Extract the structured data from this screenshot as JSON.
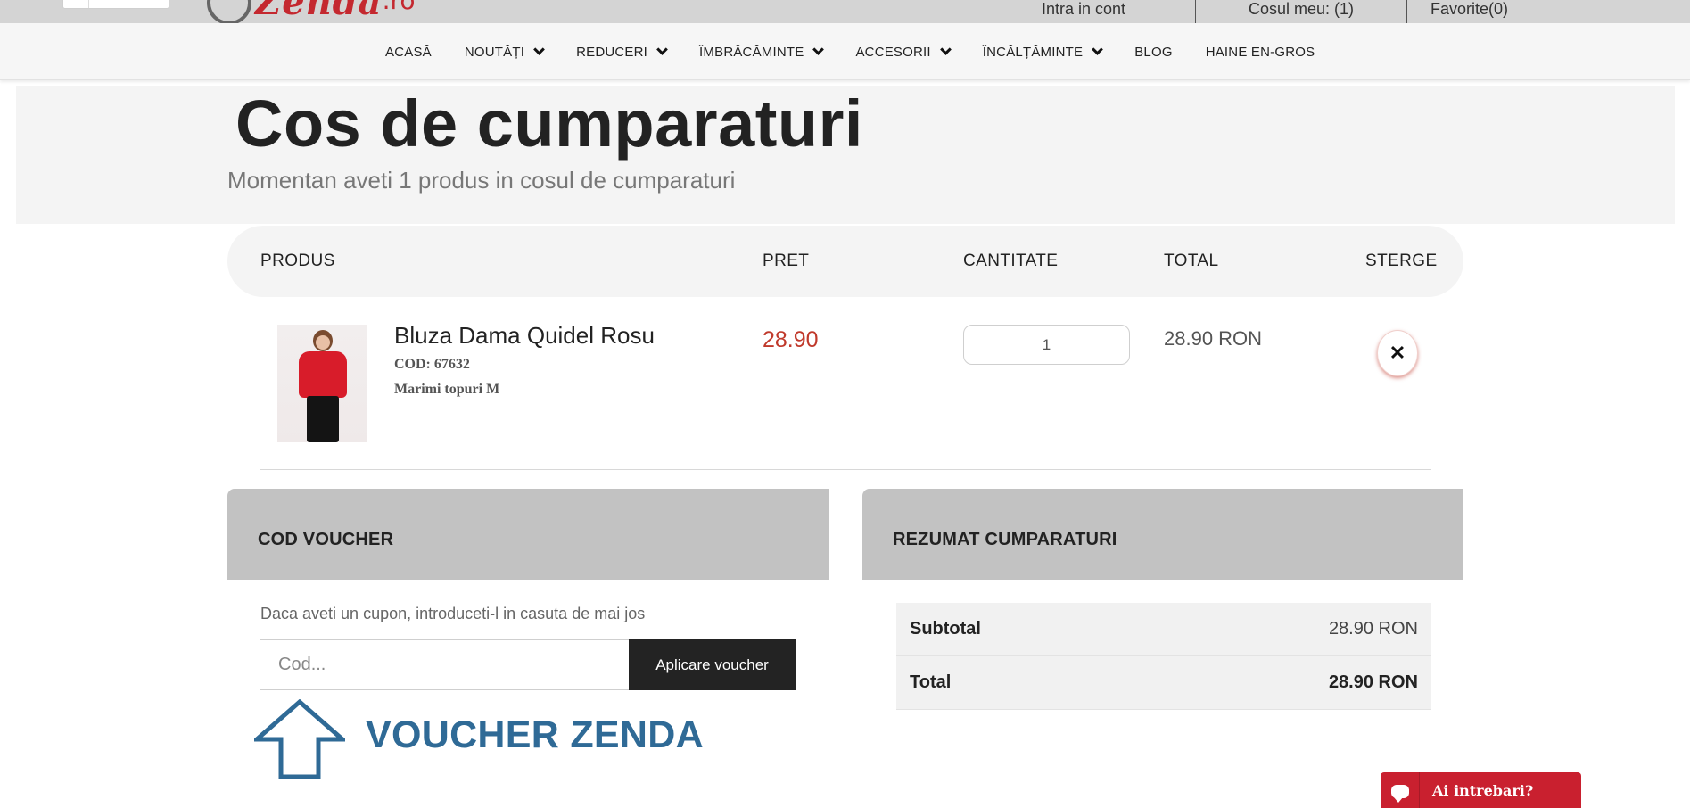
{
  "brand": {
    "logo_text": "Zenda",
    "logo_tld": ".ro",
    "accent_color": "#c4282f"
  },
  "top_links": {
    "account": "Intra in cont",
    "cart": "Cosul meu: (1)",
    "favorites": "Favorite(0)"
  },
  "nav": {
    "items": [
      {
        "label": "ACASĂ",
        "has_dropdown": false
      },
      {
        "label": "NOUTĂȚI",
        "has_dropdown": true
      },
      {
        "label": "REDUCERI",
        "has_dropdown": true
      },
      {
        "label": "ÎMBRĂCĂMINTE",
        "has_dropdown": true
      },
      {
        "label": "ACCESORII",
        "has_dropdown": true
      },
      {
        "label": "ÎNCĂLȚĂMINTE",
        "has_dropdown": true
      },
      {
        "label": "BLOG",
        "has_dropdown": false
      },
      {
        "label": "HAINE EN-GROS",
        "has_dropdown": false
      }
    ]
  },
  "hero": {
    "title": "Cos de cumparaturi",
    "subtitle": "Momentan aveti 1 produs in cosul de cumparaturi"
  },
  "cart_table": {
    "headers": {
      "product": "PRODUS",
      "price": "PRET",
      "quantity": "CANTITATE",
      "total": "TOTAL",
      "delete": "STERGE"
    },
    "items": [
      {
        "name": "Bluza Dama Quidel Rosu",
        "code": "COD: 67632",
        "size": "Marimi topuri M",
        "price": "28.90",
        "quantity": "1",
        "total": "28.90 RON",
        "delete_glyph": "✕"
      }
    ]
  },
  "voucher": {
    "title": "COD VOUCHER",
    "hint": "Daca aveti un cupon, introduceti-l in casuta de mai jos",
    "placeholder": "Cod...",
    "button_label": "Aplicare voucher",
    "overlay_text": "VOUCHER ZENDA",
    "overlay_color": "#2f6a96"
  },
  "summary": {
    "title": "REZUMAT CUMPARATURI",
    "rows": [
      {
        "label": "Subtotal",
        "value": "28.90 RON"
      },
      {
        "label": "Total",
        "value": "28.90 RON"
      }
    ]
  },
  "chat": {
    "label": "Ai intrebari?",
    "icon": "chat-bubble-icon",
    "color": "#c9202f"
  }
}
